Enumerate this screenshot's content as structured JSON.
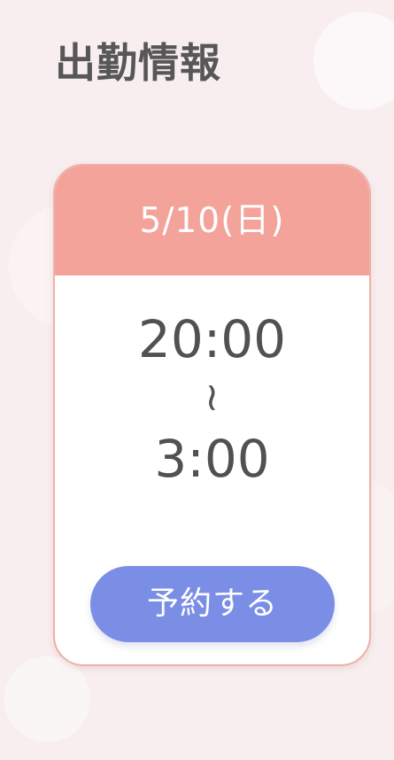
{
  "section": {
    "title": "出勤情報"
  },
  "card": {
    "date": "5/10(日)",
    "start_time": "20:00",
    "separator": "~",
    "end_time": "3:00",
    "button_label": "予約する"
  },
  "colors": {
    "header": "#f4a39b",
    "button": "#7b8ee6",
    "text": "#515151",
    "border": "#efb0a8"
  }
}
